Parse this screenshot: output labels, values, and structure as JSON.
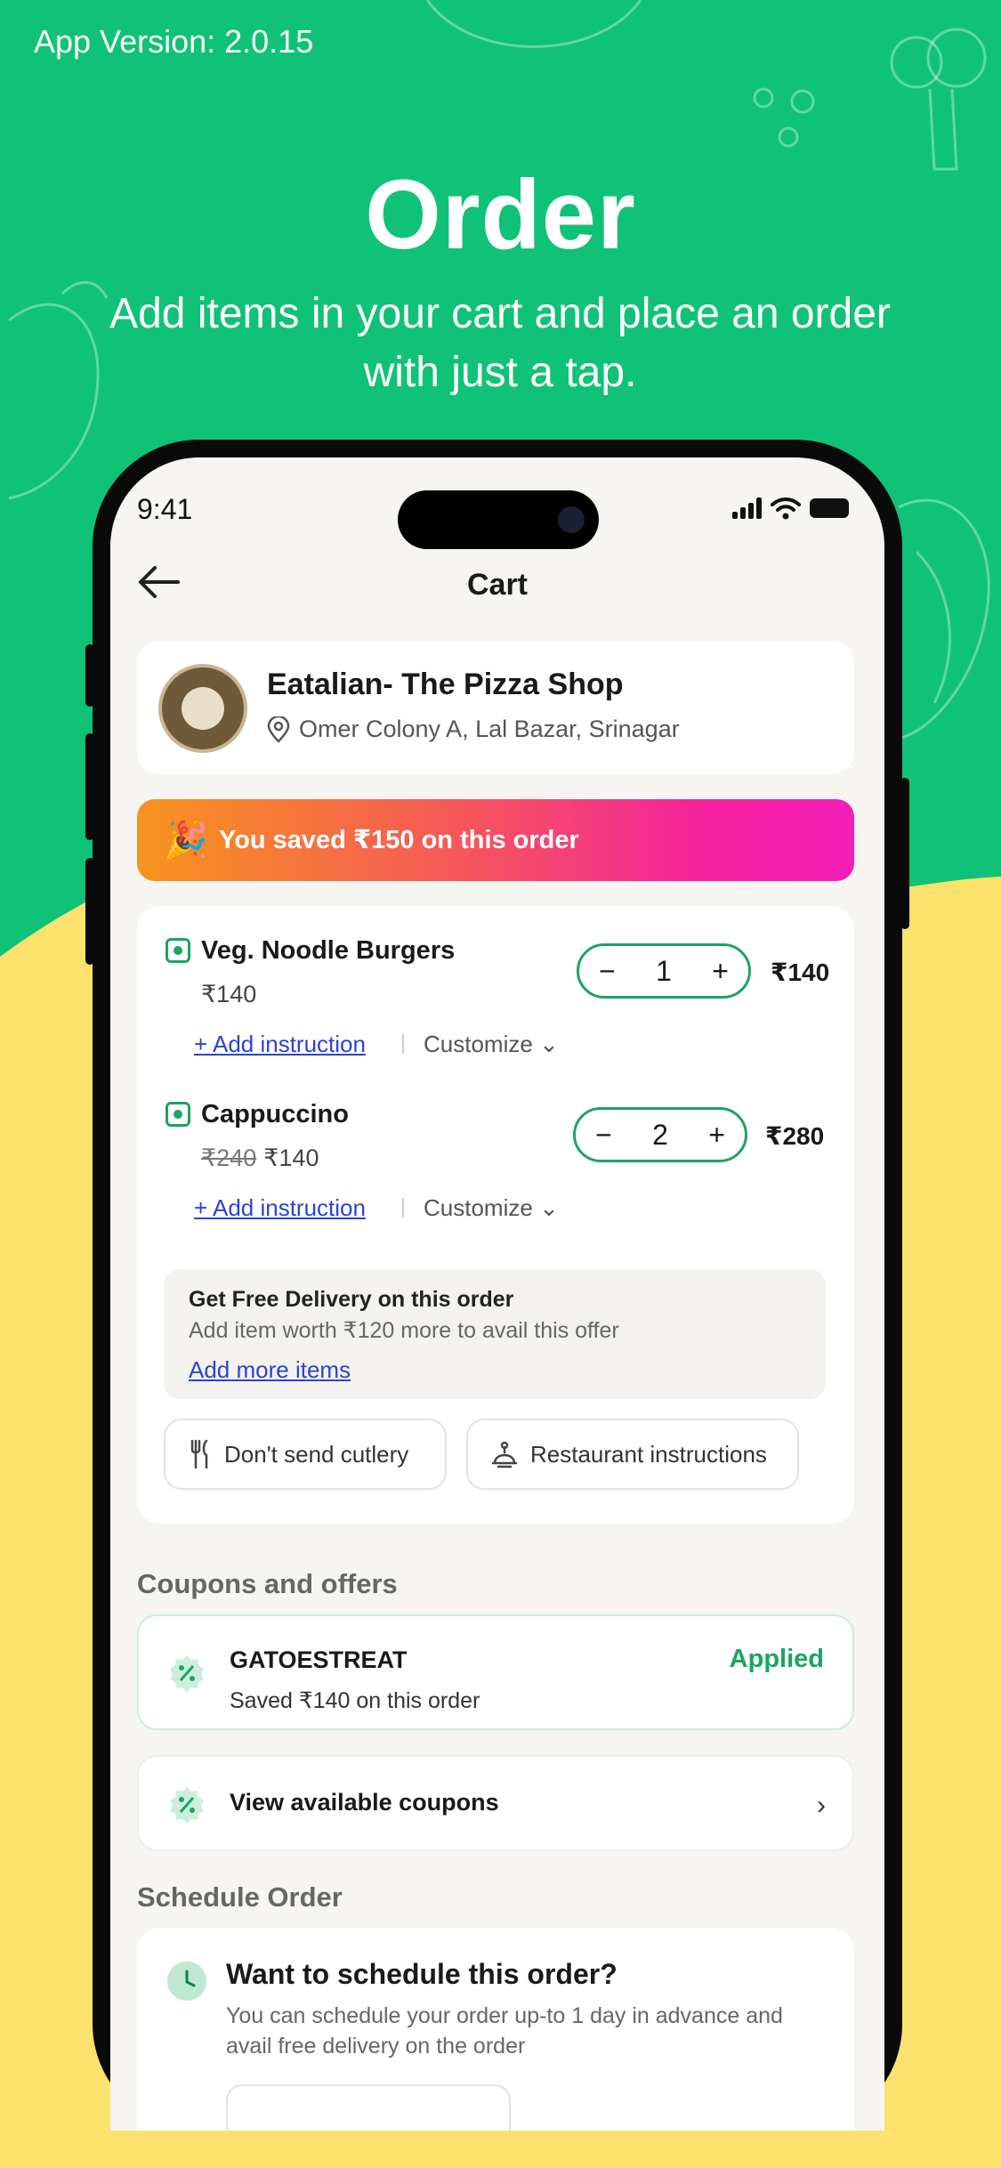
{
  "header": {
    "app_version": "App Version: 2.0.15",
    "title": "Order",
    "subtitle": "Add items in your cart and place an order with just a tap."
  },
  "colors": {
    "background_green": "#10c277",
    "background_yellow": "#fde16d",
    "accent_green": "#1aa561",
    "link_blue": "#2b43d6"
  },
  "status_bar": {
    "time": "9:41",
    "icons": [
      "signal-icon",
      "wifi-icon",
      "battery-icon"
    ]
  },
  "topbar": {
    "back_icon": "back-arrow-icon",
    "title": "Cart"
  },
  "restaurant": {
    "name": "Eatalian- The Pizza Shop",
    "address": "Omer Colony A, Lal Bazar, Srinagar"
  },
  "savings_banner": {
    "emoji": "🎉",
    "text": "You saved ₹150 on this order"
  },
  "items": [
    {
      "name": "Veg. Noodle Burgers",
      "original_price": "",
      "price": "₹140",
      "quantity": "1",
      "total": "₹140",
      "add_instruction": "+ Add instruction",
      "customize": "Customize"
    },
    {
      "name": "Cappuccino",
      "original_price": "₹240",
      "price": "₹140",
      "quantity": "2",
      "total": "₹280",
      "add_instruction": "+ Add instruction",
      "customize": "Customize"
    }
  ],
  "free_delivery": {
    "title": "Get Free Delivery on this order",
    "subtitle": "Add item worth ₹120 more to avail this offer",
    "link": "Add more items"
  },
  "options": {
    "cutlery": "Don't send cutlery",
    "restaurant_instructions": "Restaurant instructions"
  },
  "coupons": {
    "section_title": "Coupons and offers",
    "applied": {
      "code": "GATOESTREAT",
      "status": "Applied",
      "subtitle": "Saved ₹140 on this order"
    },
    "view_all": "View available coupons"
  },
  "schedule": {
    "section_title": "Schedule Order",
    "title": "Want to schedule this order?",
    "subtitle": "You can schedule your order up-to 1 day in advance and avail free delivery on the order"
  }
}
